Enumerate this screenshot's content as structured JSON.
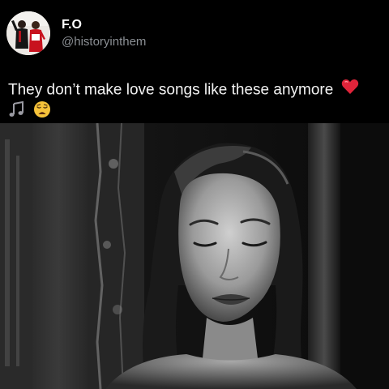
{
  "post": {
    "author": {
      "display_name": "F.O",
      "handle": "@historyinthem",
      "avatar_icon": "profile-photo"
    },
    "text": "They don’t make love songs like these anymore",
    "emojis": [
      "red-heart-icon",
      "musical-notes-icon",
      "weary-face-icon"
    ],
    "media": {
      "type": "video-still",
      "description_icon": "black-and-white-portrait"
    }
  },
  "colors": {
    "background": "#000000",
    "text": "#f2f2f2",
    "handle": "#8b8f94",
    "heart": "#e0243a",
    "emoji_yellow": "#f6c33a"
  }
}
